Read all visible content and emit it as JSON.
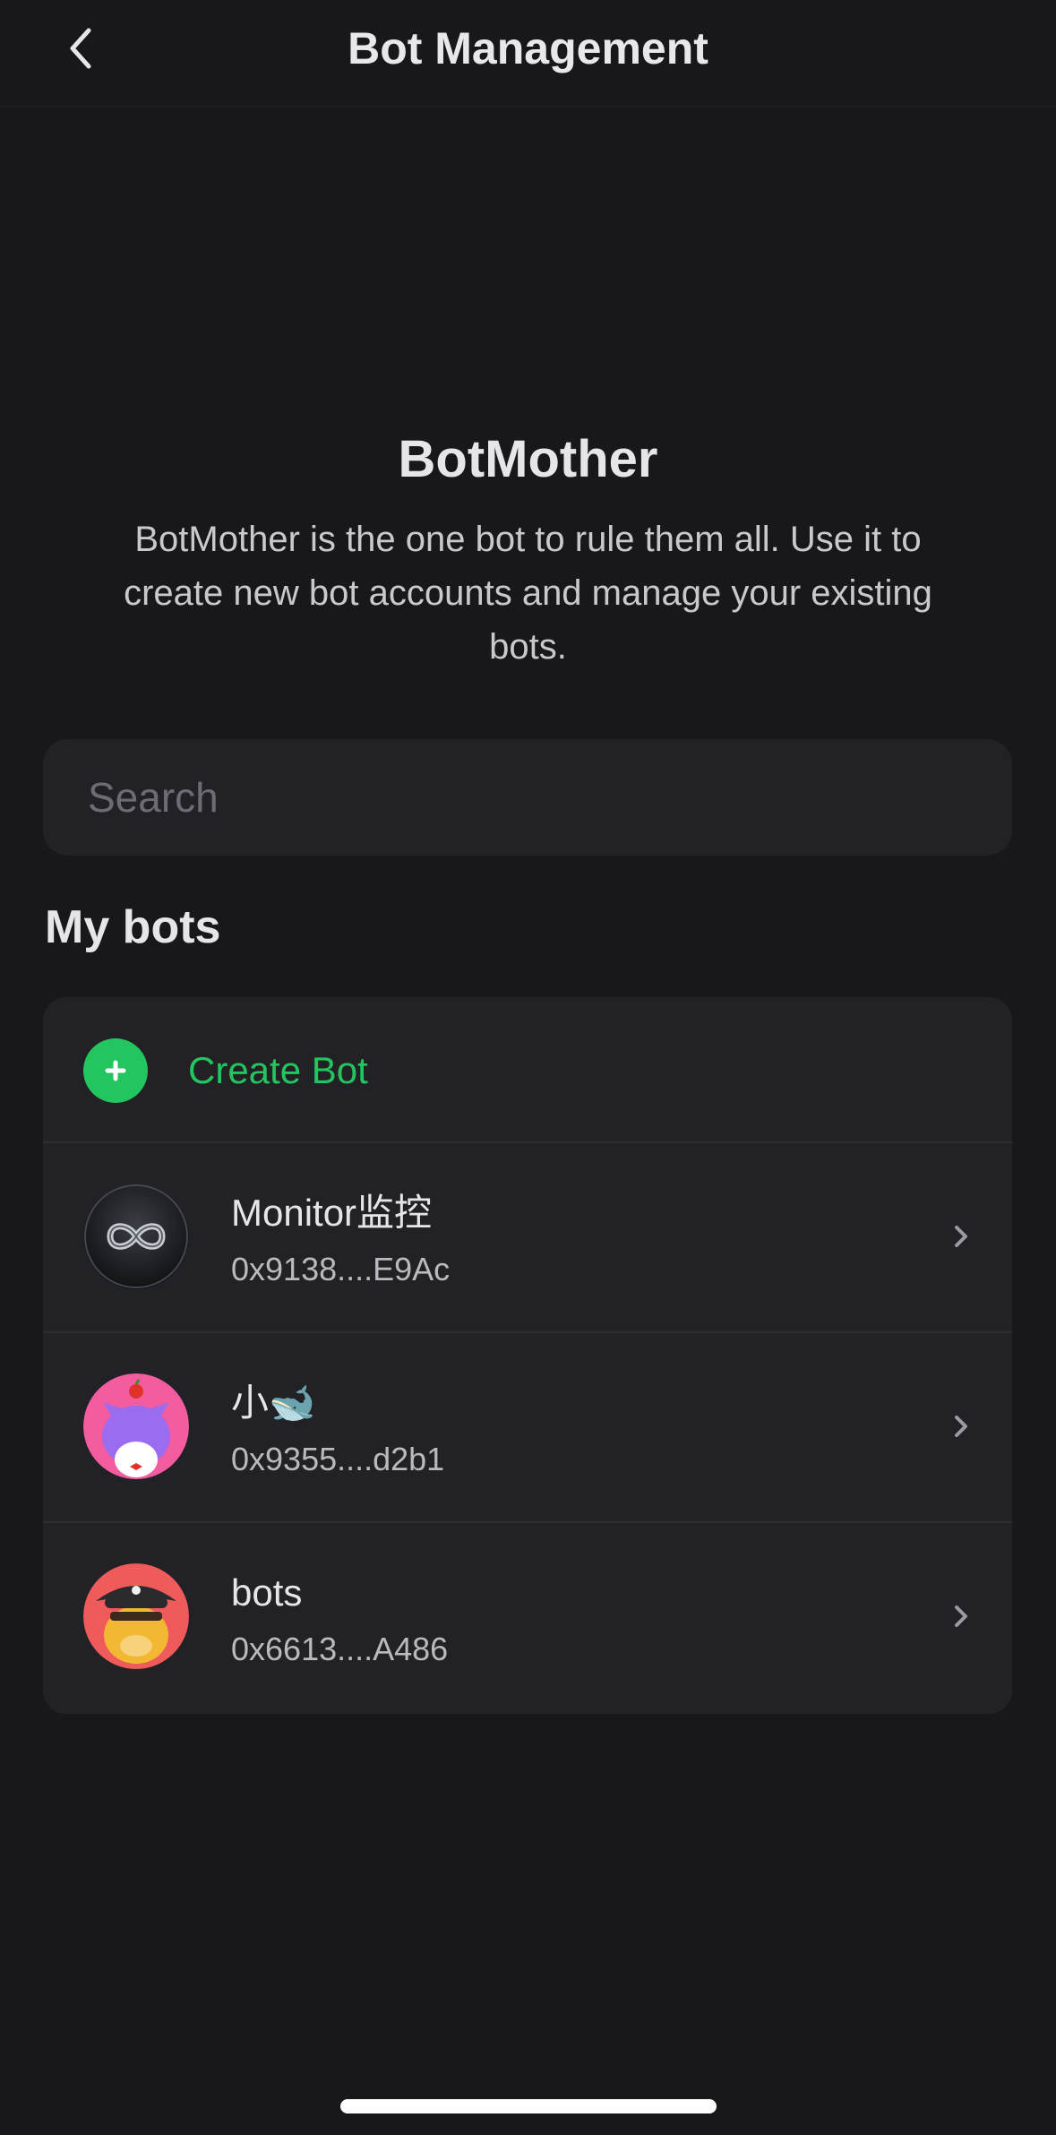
{
  "header": {
    "title": "Bot Management",
    "back_icon": "chevron-left-icon"
  },
  "hero": {
    "title": "BotMother",
    "description": "BotMother is the one bot to rule them all. Use it to create new bot accounts and manage your existing bots."
  },
  "search": {
    "placeholder": "Search",
    "value": ""
  },
  "my_bots": {
    "section_title": "My bots",
    "create_label": "Create Bot",
    "create_icon": "plus-icon",
    "accent_color": "#22c55e",
    "bots": [
      {
        "name": "Monitor监控",
        "address": "0x9138....E9Ac",
        "avatar": "infinity-avatar"
      },
      {
        "name": "小🐋",
        "address": "0x9355....d2b1",
        "avatar": "purple-cat-avatar"
      },
      {
        "name": "bots",
        "address": "0x6613....A486",
        "avatar": "pirate-cat-avatar"
      }
    ]
  }
}
